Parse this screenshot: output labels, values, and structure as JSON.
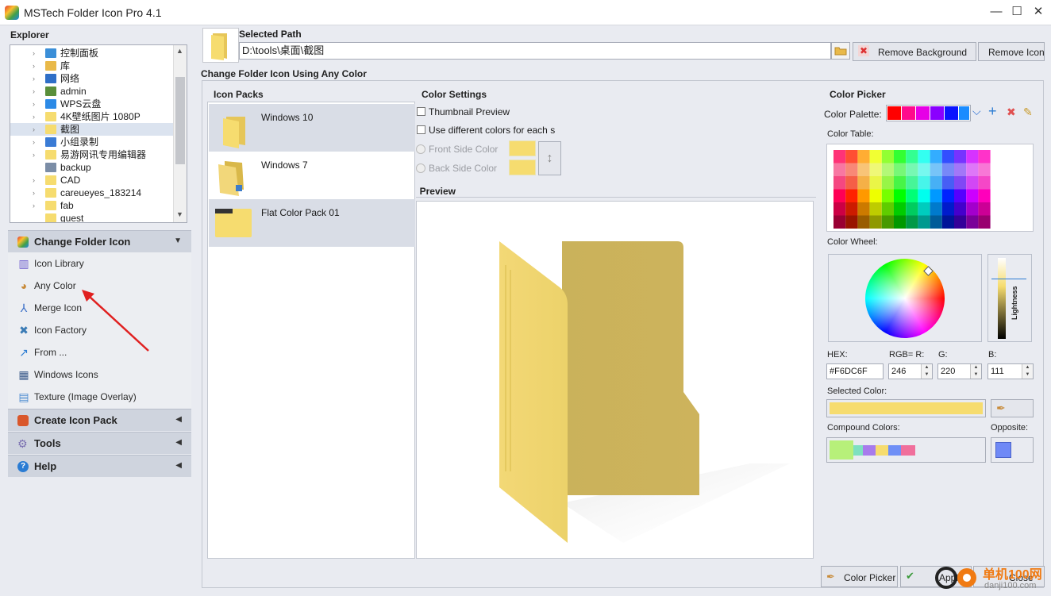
{
  "window": {
    "title": "MSTech Folder Icon Pro 4.1",
    "minimize": "—",
    "maximize": "☐",
    "close": "✕"
  },
  "explorer": {
    "label": "Explorer",
    "items": [
      {
        "label": "控制面板",
        "color": "#3b8fd8"
      },
      {
        "label": "库",
        "color": "#e9b949"
      },
      {
        "label": "网络",
        "color": "#2f6fc7"
      },
      {
        "label": "admin",
        "color": "#5a8f3a"
      },
      {
        "label": "WPS云盘",
        "color": "#2c8ae6"
      },
      {
        "label": "4K壁纸图片 1080P",
        "color": "#F6DC6F"
      },
      {
        "label": "截图",
        "color": "#F6DC6F"
      },
      {
        "label": "小组录制",
        "color": "#3a7bd5"
      },
      {
        "label": "易游网讯专用编辑器",
        "color": "#F6DC6F"
      },
      {
        "label": "backup",
        "color": "#7b8da6"
      },
      {
        "label": "CAD",
        "color": "#F6DC6F"
      },
      {
        "label": "careueyes_183214",
        "color": "#F6DC6F"
      },
      {
        "label": "fab",
        "color": "#F6DC6F"
      },
      {
        "label": "guest",
        "color": "#F6DC6F"
      }
    ]
  },
  "sidebar": {
    "change_folder_icon": "Change Folder Icon",
    "items": [
      {
        "label": "Icon Library",
        "icon": "library-icon"
      },
      {
        "label": "Any Color",
        "icon": "palette-icon"
      },
      {
        "label": "Merge Icon",
        "icon": "merge-icon"
      },
      {
        "label": "Icon Factory",
        "icon": "factory-icon"
      },
      {
        "label": "From ...",
        "icon": "from-icon"
      },
      {
        "label": "Windows Icons",
        "icon": "windows-icon"
      },
      {
        "label": "Texture (Image Overlay)",
        "icon": "texture-icon"
      }
    ],
    "create_icon_pack": "Create Icon Pack",
    "tools": "Tools",
    "help": "Help"
  },
  "path": {
    "label": "Selected Path",
    "value": "D:\\tools\\桌面\\截图",
    "remove_background": "Remove Background",
    "remove_icon": "Remove Icon"
  },
  "main": {
    "title": "Change Folder Icon Using Any Color"
  },
  "icon_packs": {
    "title": "Icon Packs",
    "items": [
      {
        "label": "Windows 10"
      },
      {
        "label": "Windows 7"
      },
      {
        "label": "Flat Color Pack 01"
      }
    ]
  },
  "color_settings": {
    "title": "Color Settings",
    "thumbnail_preview": "Thumbnail Preview",
    "different_colors": "Use different colors for each s",
    "front_side": "Front Side Color",
    "back_side": "Back Side Color",
    "swap_icon": "↕"
  },
  "preview": {
    "title": "Preview"
  },
  "color_picker": {
    "title": "Color Picker",
    "palette_label": "Color Palette:",
    "palette": [
      "#ff0000",
      "#ff0a8c",
      "#e600e6",
      "#8a00ff",
      "#0a14ff",
      "#1a8cff"
    ],
    "table_label": "Color Table:",
    "wheel_label": "Color Wheel:",
    "lightness": "Lightness",
    "hex_label": "HEX:",
    "hex_value": "#F6DC6F",
    "rgb_label": "RGB= R:",
    "r": "246",
    "g_label": "G:",
    "g": "220",
    "b_label": "B:",
    "b": "111",
    "selected_label": "Selected Color:",
    "selected_color": "#F6DC6F",
    "compound_label": "Compound Colors:",
    "compound": [
      "#b7f07a",
      "#7ee0c0",
      "#a77bec",
      "#f6dc6f",
      "#6f8ff6",
      "#f06f9c"
    ],
    "opposite_label": "Opposite:",
    "opposite_color": "#6F89F6"
  },
  "bottom": {
    "color_picker": "Color Picker",
    "apply": "Apply",
    "close": "Close"
  },
  "watermark": {
    "text1": "单机100网",
    "text2": "danji100.com"
  }
}
